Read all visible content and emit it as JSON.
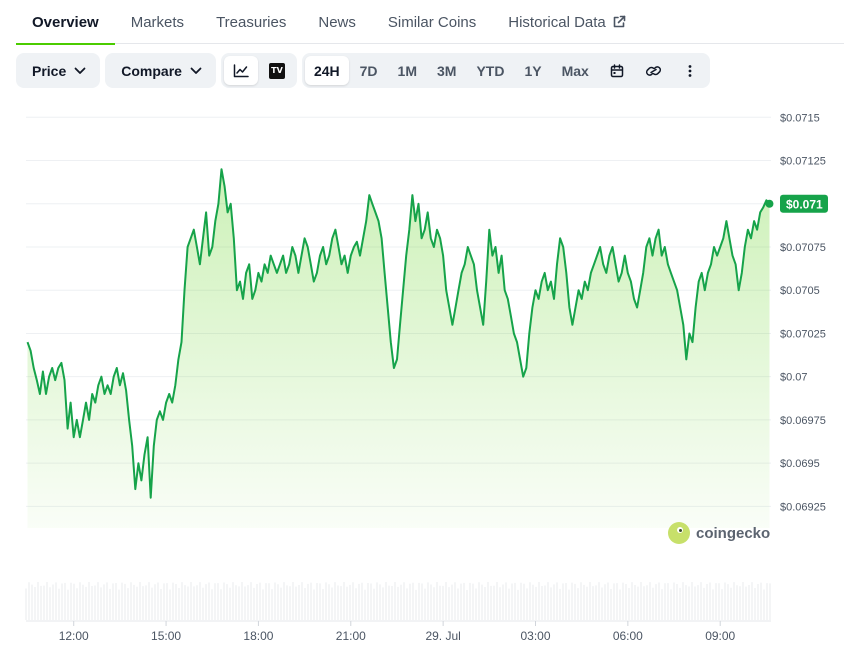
{
  "tabs": [
    {
      "label": "Overview",
      "active": true
    },
    {
      "label": "Markets"
    },
    {
      "label": "Treasuries"
    },
    {
      "label": "News"
    },
    {
      "label": "Similar Coins"
    },
    {
      "label": "Historical Data",
      "external": true
    }
  ],
  "toolbar": {
    "price_label": "Price",
    "compare_label": "Compare",
    "tradingview_icon_text": "TV",
    "ranges": [
      "24H",
      "7D",
      "1M",
      "3M",
      "YTD",
      "1Y",
      "Max"
    ],
    "active_range": "24H"
  },
  "watermark": {
    "text": "coingecko"
  },
  "colors": {
    "line": "#16a34a",
    "accent": "#4bcc00",
    "badge": "#16a34a",
    "grid": "#eef0f3"
  },
  "chart_data": {
    "type": "area",
    "ylim": [
      0.069125,
      0.0716
    ],
    "yticks": [
      0.0715,
      0.07125,
      0.071,
      0.07075,
      0.0705,
      0.07025,
      0.07,
      0.06975,
      0.0695,
      0.06925
    ],
    "ytick_labels": [
      "$0.0715",
      "$0.07125",
      "$0.071",
      "$0.07075",
      "$0.0705",
      "$0.07025",
      "$0.07",
      "$0.06975",
      "$0.0695",
      "$0.06925"
    ],
    "xlim_hours": [
      10.45,
      34.65
    ],
    "xticks": [
      {
        "hour": 12,
        "label": "12:00"
      },
      {
        "hour": 15,
        "label": "15:00"
      },
      {
        "hour": 18,
        "label": "18:00"
      },
      {
        "hour": 21,
        "label": "21:00"
      },
      {
        "hour": 24,
        "label": "29. Jul"
      },
      {
        "hour": 27,
        "label": "03:00"
      },
      {
        "hour": 30,
        "label": "06:00"
      },
      {
        "hour": 33,
        "label": "09:00"
      }
    ],
    "grid": true,
    "current_price_label": "$0.071",
    "series": [
      {
        "points": [
          [
            10.5,
            0.0702
          ],
          [
            10.6,
            0.07015
          ],
          [
            10.7,
            0.07005
          ],
          [
            10.8,
            0.06998
          ],
          [
            10.9,
            0.0699
          ],
          [
            11.0,
            0.07003
          ],
          [
            11.1,
            0.0699
          ],
          [
            11.2,
            0.07
          ],
          [
            11.3,
            0.07005
          ],
          [
            11.4,
            0.06998
          ],
          [
            11.5,
            0.07005
          ],
          [
            11.6,
            0.07008
          ],
          [
            11.7,
            0.06998
          ],
          [
            11.8,
            0.0697
          ],
          [
            11.9,
            0.06985
          ],
          [
            12.0,
            0.06965
          ],
          [
            12.1,
            0.06975
          ],
          [
            12.2,
            0.06965
          ],
          [
            12.3,
            0.06975
          ],
          [
            12.4,
            0.06985
          ],
          [
            12.5,
            0.06975
          ],
          [
            12.6,
            0.0699
          ],
          [
            12.7,
            0.06985
          ],
          [
            12.8,
            0.06995
          ],
          [
            12.9,
            0.07
          ],
          [
            13.0,
            0.0699
          ],
          [
            13.1,
            0.06995
          ],
          [
            13.2,
            0.0699
          ],
          [
            13.3,
            0.07
          ],
          [
            13.4,
            0.07005
          ],
          [
            13.5,
            0.06995
          ],
          [
            13.6,
            0.07002
          ],
          [
            13.7,
            0.06992
          ],
          [
            13.8,
            0.06975
          ],
          [
            13.9,
            0.0696
          ],
          [
            14.0,
            0.06935
          ],
          [
            14.1,
            0.0695
          ],
          [
            14.2,
            0.0694
          ],
          [
            14.3,
            0.06955
          ],
          [
            14.4,
            0.06965
          ],
          [
            14.5,
            0.0693
          ],
          [
            14.6,
            0.0696
          ],
          [
            14.7,
            0.06975
          ],
          [
            14.8,
            0.0698
          ],
          [
            14.9,
            0.06975
          ],
          [
            15.0,
            0.06985
          ],
          [
            15.1,
            0.0699
          ],
          [
            15.2,
            0.06985
          ],
          [
            15.3,
            0.06995
          ],
          [
            15.4,
            0.0701
          ],
          [
            15.5,
            0.0702
          ],
          [
            15.6,
            0.0705
          ],
          [
            15.7,
            0.07075
          ],
          [
            15.8,
            0.0708
          ],
          [
            15.9,
            0.07085
          ],
          [
            16.0,
            0.07075
          ],
          [
            16.1,
            0.07065
          ],
          [
            16.2,
            0.0708
          ],
          [
            16.3,
            0.07095
          ],
          [
            16.4,
            0.0707
          ],
          [
            16.5,
            0.07075
          ],
          [
            16.6,
            0.0709
          ],
          [
            16.7,
            0.071
          ],
          [
            16.8,
            0.0712
          ],
          [
            16.9,
            0.0711
          ],
          [
            17.0,
            0.07095
          ],
          [
            17.1,
            0.071
          ],
          [
            17.2,
            0.0708
          ],
          [
            17.3,
            0.0705
          ],
          [
            17.4,
            0.07055
          ],
          [
            17.5,
            0.07045
          ],
          [
            17.6,
            0.0706
          ],
          [
            17.7,
            0.07065
          ],
          [
            17.8,
            0.07045
          ],
          [
            17.9,
            0.0705
          ],
          [
            18.0,
            0.0706
          ],
          [
            18.1,
            0.07055
          ],
          [
            18.2,
            0.07065
          ],
          [
            18.3,
            0.0706
          ],
          [
            18.4,
            0.0707
          ],
          [
            18.5,
            0.07065
          ],
          [
            18.6,
            0.0706
          ],
          [
            18.7,
            0.07065
          ],
          [
            18.8,
            0.0707
          ],
          [
            18.9,
            0.0706
          ],
          [
            19.0,
            0.07065
          ],
          [
            19.1,
            0.07075
          ],
          [
            19.2,
            0.0707
          ],
          [
            19.3,
            0.0706
          ],
          [
            19.4,
            0.0707
          ],
          [
            19.5,
            0.0708
          ],
          [
            19.6,
            0.07075
          ],
          [
            19.7,
            0.07065
          ],
          [
            19.8,
            0.07055
          ],
          [
            19.9,
            0.0706
          ],
          [
            20.0,
            0.0707
          ],
          [
            20.1,
            0.07075
          ],
          [
            20.2,
            0.07065
          ],
          [
            20.3,
            0.0707
          ],
          [
            20.4,
            0.0708
          ],
          [
            20.5,
            0.07085
          ],
          [
            20.6,
            0.07075
          ],
          [
            20.7,
            0.07065
          ],
          [
            20.8,
            0.0707
          ],
          [
            20.9,
            0.0706
          ],
          [
            21.0,
            0.0707
          ],
          [
            21.1,
            0.07075
          ],
          [
            21.2,
            0.07078
          ],
          [
            21.3,
            0.0707
          ],
          [
            21.4,
            0.0708
          ],
          [
            21.5,
            0.0709
          ],
          [
            21.6,
            0.07105
          ],
          [
            21.7,
            0.071
          ],
          [
            21.8,
            0.07095
          ],
          [
            21.9,
            0.0709
          ],
          [
            22.0,
            0.0708
          ],
          [
            22.1,
            0.0706
          ],
          [
            22.2,
            0.0704
          ],
          [
            22.3,
            0.0702
          ],
          [
            22.4,
            0.07005
          ],
          [
            22.5,
            0.0701
          ],
          [
            22.6,
            0.0703
          ],
          [
            22.7,
            0.0705
          ],
          [
            22.8,
            0.0707
          ],
          [
            22.9,
            0.07085
          ],
          [
            23.0,
            0.07105
          ],
          [
            23.1,
            0.0709
          ],
          [
            23.2,
            0.071
          ],
          [
            23.3,
            0.0708
          ],
          [
            23.4,
            0.07085
          ],
          [
            23.5,
            0.07095
          ],
          [
            23.6,
            0.0708
          ],
          [
            23.7,
            0.07075
          ],
          [
            23.8,
            0.07085
          ],
          [
            23.9,
            0.0708
          ],
          [
            24.0,
            0.0707
          ],
          [
            24.1,
            0.0705
          ],
          [
            24.2,
            0.0704
          ],
          [
            24.3,
            0.0703
          ],
          [
            24.4,
            0.0704
          ],
          [
            24.5,
            0.0705
          ],
          [
            24.6,
            0.0706
          ],
          [
            24.7,
            0.07065
          ],
          [
            24.8,
            0.07075
          ],
          [
            24.9,
            0.0707
          ],
          [
            25.0,
            0.07065
          ],
          [
            25.1,
            0.0705
          ],
          [
            25.2,
            0.0704
          ],
          [
            25.3,
            0.0703
          ],
          [
            25.4,
            0.07055
          ],
          [
            25.5,
            0.07085
          ],
          [
            25.6,
            0.0707
          ],
          [
            25.7,
            0.07075
          ],
          [
            25.8,
            0.0706
          ],
          [
            25.9,
            0.0707
          ],
          [
            26.0,
            0.0705
          ],
          [
            26.1,
            0.07045
          ],
          [
            26.2,
            0.07035
          ],
          [
            26.3,
            0.07025
          ],
          [
            26.4,
            0.0702
          ],
          [
            26.5,
            0.0701
          ],
          [
            26.6,
            0.07
          ],
          [
            26.7,
            0.07005
          ],
          [
            26.8,
            0.07025
          ],
          [
            26.9,
            0.0704
          ],
          [
            27.0,
            0.0705
          ],
          [
            27.1,
            0.07045
          ],
          [
            27.2,
            0.07055
          ],
          [
            27.3,
            0.0706
          ],
          [
            27.4,
            0.0705
          ],
          [
            27.5,
            0.07055
          ],
          [
            27.6,
            0.07045
          ],
          [
            27.7,
            0.07065
          ],
          [
            27.8,
            0.0708
          ],
          [
            27.9,
            0.07075
          ],
          [
            28.0,
            0.0706
          ],
          [
            28.1,
            0.0704
          ],
          [
            28.2,
            0.0703
          ],
          [
            28.3,
            0.0704
          ],
          [
            28.4,
            0.0705
          ],
          [
            28.5,
            0.07045
          ],
          [
            28.6,
            0.07055
          ],
          [
            28.7,
            0.0705
          ],
          [
            28.8,
            0.0706
          ],
          [
            28.9,
            0.07065
          ],
          [
            29.0,
            0.0707
          ],
          [
            29.1,
            0.07075
          ],
          [
            29.2,
            0.07065
          ],
          [
            29.3,
            0.0706
          ],
          [
            29.4,
            0.0707
          ],
          [
            29.5,
            0.07075
          ],
          [
            29.6,
            0.07065
          ],
          [
            29.7,
            0.07055
          ],
          [
            29.8,
            0.0706
          ],
          [
            29.9,
            0.0707
          ],
          [
            30.0,
            0.0706
          ],
          [
            30.1,
            0.07055
          ],
          [
            30.2,
            0.07045
          ],
          [
            30.3,
            0.0704
          ],
          [
            30.4,
            0.0705
          ],
          [
            30.5,
            0.0706
          ],
          [
            30.6,
            0.07075
          ],
          [
            30.7,
            0.0708
          ],
          [
            30.8,
            0.0707
          ],
          [
            30.9,
            0.0708
          ],
          [
            31.0,
            0.07085
          ],
          [
            31.1,
            0.0707
          ],
          [
            31.2,
            0.07075
          ],
          [
            31.3,
            0.07065
          ],
          [
            31.4,
            0.0706
          ],
          [
            31.5,
            0.07055
          ],
          [
            31.6,
            0.0705
          ],
          [
            31.7,
            0.0704
          ],
          [
            31.8,
            0.0703
          ],
          [
            31.9,
            0.0701
          ],
          [
            32.0,
            0.07025
          ],
          [
            32.1,
            0.0702
          ],
          [
            32.2,
            0.0704
          ],
          [
            32.3,
            0.07055
          ],
          [
            32.4,
            0.0706
          ],
          [
            32.5,
            0.0705
          ],
          [
            32.6,
            0.0706
          ],
          [
            32.7,
            0.07065
          ],
          [
            32.8,
            0.07075
          ],
          [
            32.9,
            0.0707
          ],
          [
            33.0,
            0.07075
          ],
          [
            33.1,
            0.0708
          ],
          [
            33.2,
            0.0709
          ],
          [
            33.3,
            0.0708
          ],
          [
            33.4,
            0.0707
          ],
          [
            33.5,
            0.07065
          ],
          [
            33.6,
            0.0705
          ],
          [
            33.7,
            0.0706
          ],
          [
            33.8,
            0.07075
          ],
          [
            33.9,
            0.07085
          ],
          [
            34.0,
            0.0708
          ],
          [
            34.1,
            0.0709
          ],
          [
            34.2,
            0.07085
          ],
          [
            34.3,
            0.07095
          ],
          [
            34.4,
            0.07098
          ],
          [
            34.5,
            0.07102
          ],
          [
            34.6,
            0.071
          ]
        ]
      }
    ]
  }
}
